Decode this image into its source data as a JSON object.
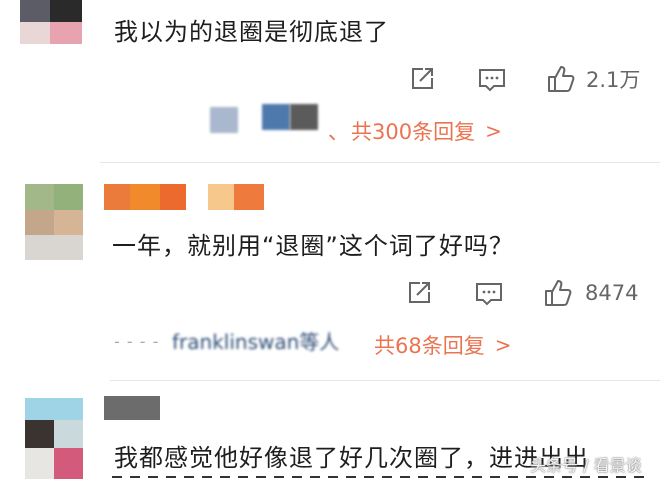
{
  "comments": [
    {
      "text": "我以为的退圈是彻底退了",
      "likes": "2.1万",
      "replies_label": "共300条回复"
    },
    {
      "text": "一年，就别用“退圈”这个词了好吗？",
      "likes": "8474",
      "replies_label": "共68条回复",
      "reply_user_fragment": "franklinswan等人"
    },
    {
      "text": "我都感觉他好像退了好几次圈了，进进出出"
    }
  ],
  "watermark": "头条号 / 看景谈",
  "icons": {
    "share": "share-icon",
    "comment": "comment-icon",
    "like": "thumbs-up-icon",
    "chevron": "chevron-right-icon"
  },
  "colors": {
    "accent": "#eb7350",
    "text": "#1e1e1e",
    "muted": "#666666"
  }
}
